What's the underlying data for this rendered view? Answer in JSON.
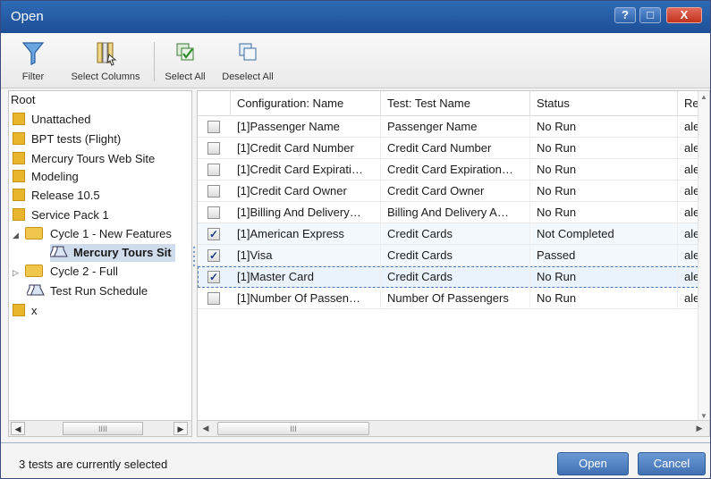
{
  "window": {
    "title": "Open",
    "help_label": "?",
    "maximize_label": "□",
    "close_label": "X"
  },
  "toolbar": {
    "filter_label": "Filter",
    "select_columns_label": "Select Columns",
    "select_all_label": "Select All",
    "deselect_all_label": "Deselect All"
  },
  "tree": {
    "root_label": "Root",
    "items": [
      {
        "label": "Unattached",
        "icon": "folder-icon"
      },
      {
        "label": "BPT tests (Flight)",
        "icon": "folder-icon"
      },
      {
        "label": "Mercury Tours Web Site",
        "icon": "folder-icon"
      },
      {
        "label": "Modeling",
        "icon": "folder-icon"
      },
      {
        "label": "Release 10.5",
        "icon": "folder-icon"
      },
      {
        "label": "Service Pack 1",
        "icon": "folder-icon"
      },
      {
        "label": "Cycle 1 - New Features",
        "icon": "open-folder-icon"
      },
      {
        "label": "Mercury Tours Sit",
        "icon": "test-set-icon"
      },
      {
        "label": "Cycle 2 - Full",
        "icon": "folder-icon"
      },
      {
        "label": "Test Run Schedule",
        "icon": "test-set-icon"
      },
      {
        "label": "x",
        "icon": "folder-icon"
      }
    ],
    "scroll_thumb_grip": "IIII"
  },
  "grid": {
    "columns": [
      "Configuration: Name",
      "Test: Test Name",
      "Status",
      "Re"
    ],
    "rows": [
      {
        "checked": false,
        "config": "[1]Passenger Name",
        "test": "Passenger Name",
        "status": "No Run",
        "re": "ale"
      },
      {
        "checked": false,
        "config": "[1]Credit Card Number",
        "test": "Credit Card Number",
        "status": "No Run",
        "re": "ale"
      },
      {
        "checked": false,
        "config": "[1]Credit Card Expirati…",
        "test": "Credit Card Expiration…",
        "status": "No Run",
        "re": "ale"
      },
      {
        "checked": false,
        "config": "[1]Credit Card Owner",
        "test": "Credit Card Owner",
        "status": "No Run",
        "re": "ale"
      },
      {
        "checked": false,
        "config": "[1]Billing And Delivery…",
        "test": "Billing And Delivery A…",
        "status": "No Run",
        "re": "ale"
      },
      {
        "checked": true,
        "config": "[1]American Express",
        "test": "Credit Cards",
        "status": "Not Completed",
        "re": "ale"
      },
      {
        "checked": true,
        "config": "[1]Visa",
        "test": "Credit Cards",
        "status": "Passed",
        "re": "ale"
      },
      {
        "checked": true,
        "config": "[1]Master Card",
        "test": "Credit Cards",
        "status": "No Run",
        "re": "ale"
      },
      {
        "checked": false,
        "config": "[1]Number Of Passen…",
        "test": "Number Of Passengers",
        "status": "No Run",
        "re": "ale"
      }
    ],
    "check_mark": "✓",
    "scroll_thumb_grip": "III"
  },
  "status": {
    "text": "3 tests are currently selected"
  },
  "buttons": {
    "open_label": "Open",
    "cancel_label": "Cancel"
  },
  "colors": {
    "title_bar": "#1d4f97",
    "button_blue": "#3f70b3",
    "folder": "#e9b52c"
  }
}
